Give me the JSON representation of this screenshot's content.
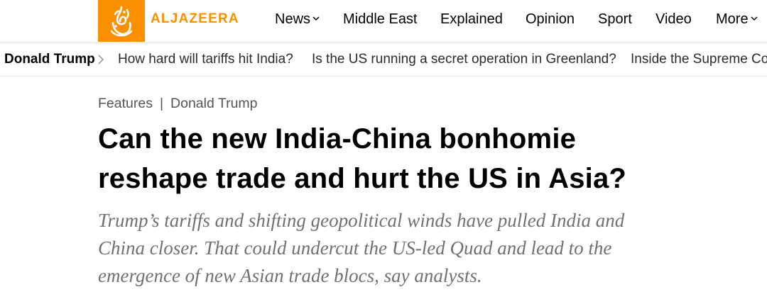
{
  "header": {
    "brand": "ALJAZEERA",
    "brand_color": "#fa9000",
    "nav": [
      {
        "label": "News",
        "has_dropdown": true
      },
      {
        "label": "Middle East",
        "has_dropdown": false
      },
      {
        "label": "Explained",
        "has_dropdown": false
      },
      {
        "label": "Opinion",
        "has_dropdown": false
      },
      {
        "label": "Sport",
        "has_dropdown": false
      },
      {
        "label": "Video",
        "has_dropdown": false
      },
      {
        "label": "More",
        "has_dropdown": true
      }
    ]
  },
  "trending": {
    "topic": "Donald Trump",
    "links": [
      "How hard will tariffs hit India?",
      "Is the US running a secret operation in Greenland?",
      "Inside the Supreme Court"
    ]
  },
  "article": {
    "breadcrumb": [
      "Features",
      "Donald Trump"
    ],
    "headline_lines": [
      "Can the new India-China bonhomie",
      "reshape trade and hurt the US in Asia?"
    ],
    "subhead_lines": [
      "Trump’s tariffs and shifting geopolitical winds have pulled India and",
      "China closer. That could undercut the US-led Quad and lead to the",
      "emergence of new Asian trade blocs, say analysts."
    ]
  }
}
